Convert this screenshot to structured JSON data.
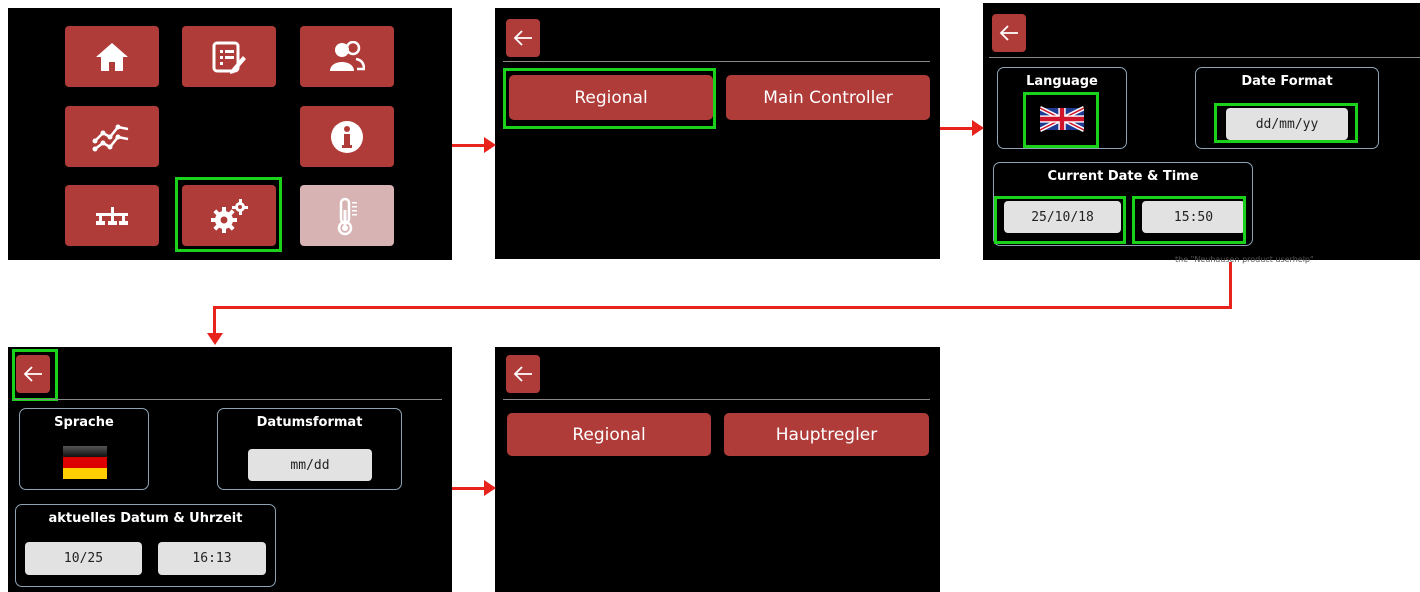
{
  "panel1": {
    "icons": [
      "home-icon",
      "checklist-edit-icon",
      "users-icon",
      "trend-chart-icon",
      "info-icon",
      "network-icon",
      "settings-gears-icon",
      "thermometer-icon"
    ]
  },
  "panel2": {
    "buttons": [
      "Regional",
      "Main Controller"
    ]
  },
  "panel3": {
    "language_title": "Language",
    "date_format_title": "Date Format",
    "date_format_value": "dd/mm/yy",
    "datetime_title": "Current Date & Time",
    "date_value": "25/10/18",
    "time_value": "15:50",
    "flag": "uk-flag-icon",
    "faint_text": "the \"Neuhausen product userhelp\""
  },
  "panel4": {
    "language_title": "Sprache",
    "date_format_title": "Datumsformat",
    "date_format_value": "mm/dd",
    "datetime_title": "aktuelles Datum & Uhrzeit",
    "date_value": "10/25",
    "time_value": "16:13",
    "flag": "germany-flag-icon"
  },
  "panel5": {
    "buttons": [
      "Regional",
      "Hauptregler"
    ]
  },
  "colors": {
    "tile": "#b03c3a",
    "highlight": "#19d219",
    "arrow": "#e8231b",
    "field": "#e2e2e2"
  }
}
